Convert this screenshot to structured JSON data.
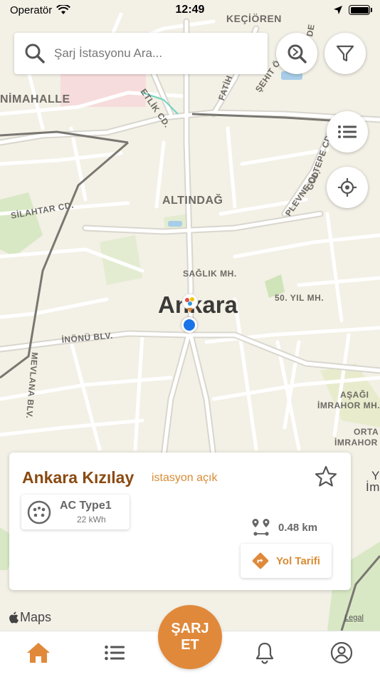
{
  "status_bar": {
    "carrier": "Operatör",
    "time": "12:49"
  },
  "search": {
    "placeholder": "Şarj İstasyonu Ara..."
  },
  "map": {
    "labels": {
      "kecioren": "KEÇİÖREN",
      "nimahalle": "NİMAHALLE",
      "etlik": "ETLİK CD.",
      "fatih": "FATİH",
      "sehit": "ŞEHİT Ö.",
      "de": "DE",
      "silahtar": "SİLAHTAR CD.",
      "altindag": "ALTINDAĞ",
      "gultepe": "GÜLTEPE CD.",
      "plevne": "PLEVNE CD.",
      "saglik": "SAĞLIK MH.",
      "ankara": "Ankara",
      "elli_yil": "50. YIL MH.",
      "inonu": "İNÖNÜ BLV.",
      "mevlana": "MEVLANA BLV.",
      "asagi": "AŞAĞI",
      "imrahor": "İMRAHOR MH.",
      "orta": "ORTA",
      "imrahor2": "İMRAHOR",
      "y": "Y",
      "im": "İm"
    },
    "attribution": "Maps",
    "legal": "Legal"
  },
  "station": {
    "name": "Ankara Kızılay",
    "status": "istasyon açık",
    "connector_type": "AC Type1",
    "connector_power": "22 kWh",
    "distance": "0.48 km",
    "route_label": "Yol Tarifi"
  },
  "tab_bar": {
    "charge_line1": "ŞARJ",
    "charge_line2": "ET"
  },
  "colors": {
    "accent": "#e0893a",
    "station_name": "#8a4a11",
    "user_location": "#1a73e8"
  },
  "battery_level": 1.0
}
